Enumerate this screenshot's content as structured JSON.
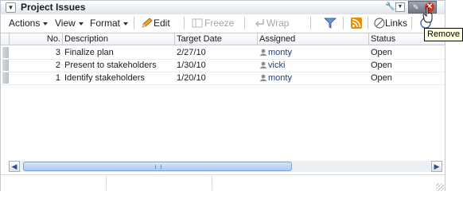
{
  "panel": {
    "title": "Project Issues",
    "tooltip": "Remove"
  },
  "toolbar": {
    "actions_label": "Actions",
    "view_label": "View",
    "format_label": "Format",
    "edit_label": "Edit",
    "freeze_label": "Freeze",
    "wrap_label": "Wrap",
    "links_label": "Links"
  },
  "table": {
    "columns": [
      "No.",
      "Description",
      "Target Date",
      "Assigned",
      "Status"
    ],
    "rows": [
      {
        "no": "3",
        "description": "Finalize plan",
        "target_date": "2/27/10",
        "assigned": "monty",
        "status": "Open"
      },
      {
        "no": "2",
        "description": "Present to stakeholders",
        "target_date": "1/30/10",
        "assigned": "vicki",
        "status": "Open"
      },
      {
        "no": "1",
        "description": "Identify stakeholders",
        "target_date": "1/20/10",
        "assigned": "monty",
        "status": "Open"
      }
    ]
  },
  "colors": {
    "accent": "#1a3e8c",
    "close": "#d6301f",
    "rss": "#f08a00",
    "tooltip_bg": "#ffffe1"
  }
}
